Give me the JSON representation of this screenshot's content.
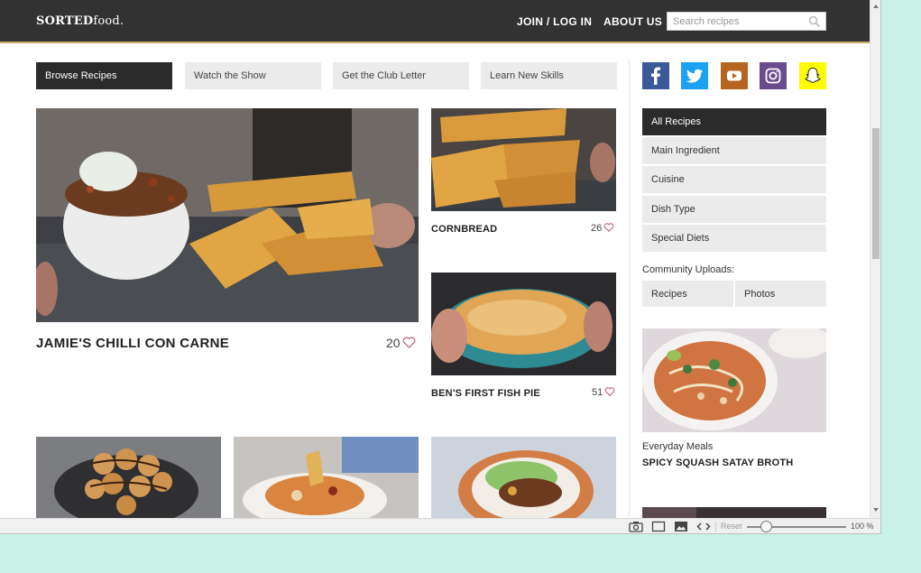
{
  "header": {
    "logo_bold": "SORTED",
    "logo_light": "food.",
    "join_label": "JOIN / LOG IN",
    "about_label": "ABOUT US",
    "search_placeholder": "Search recipes"
  },
  "tabs": [
    {
      "label": "Browse Recipes",
      "active": true
    },
    {
      "label": "Watch the Show"
    },
    {
      "label": "Get the Club Letter"
    },
    {
      "label": "Learn New Skills"
    }
  ],
  "recipes": {
    "featured": {
      "title": "JAMIE'S CHILLI CON CARNE",
      "likes": "20"
    },
    "cornbread": {
      "title": "CORNBREAD",
      "likes": "26"
    },
    "fish_pie": {
      "title": "BEN'S FIRST FISH PIE",
      "likes": "51"
    }
  },
  "social": [
    "facebook-icon",
    "twitter-icon",
    "youtube-icon",
    "instagram-icon",
    "snapchat-icon"
  ],
  "sidebar": {
    "filters": [
      {
        "label": "All Recipes",
        "active": true
      },
      {
        "label": "Main Ingredient"
      },
      {
        "label": "Cuisine"
      },
      {
        "label": "Dish Type"
      },
      {
        "label": "Special Diets"
      }
    ],
    "community_label": "Community Uploads:",
    "community_buttons": [
      "Recipes",
      "Photos"
    ],
    "promo": {
      "category": "Everyday Meals",
      "title": "SPICY SQUASH SATAY BROTH"
    }
  },
  "statusbar": {
    "reset_label": "Reset",
    "zoom": "100 %"
  },
  "colors": {
    "header_bg": "#323232",
    "tab_active": "#2b2b2b",
    "tab_inactive": "#ebebeb",
    "heart": "#c0698a",
    "facebook": "#3b5998",
    "twitter": "#1da1f2",
    "youtube": "#b5651d",
    "instagram": "#6a4b8c",
    "snapchat": "#fffc00"
  }
}
